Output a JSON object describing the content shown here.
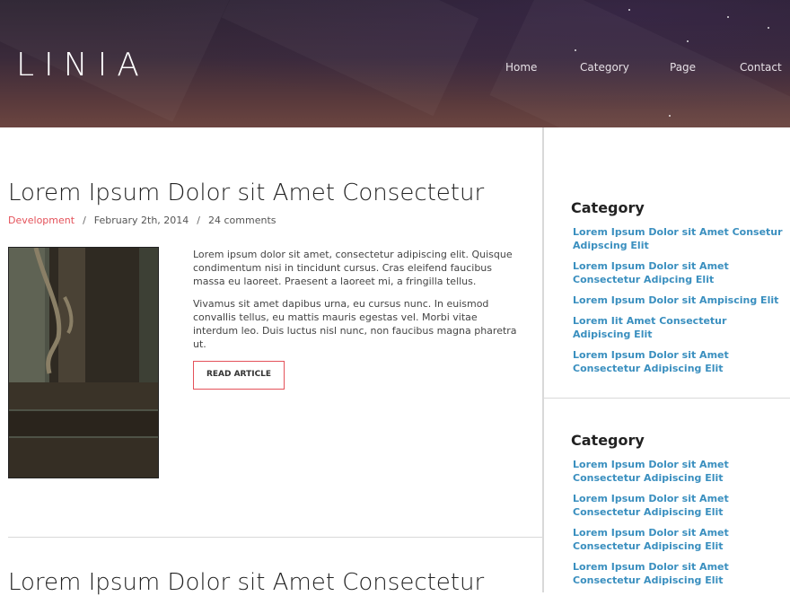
{
  "header": {
    "logo": "LINIA",
    "nav": [
      "Home",
      "Category",
      "Page",
      "Contact"
    ]
  },
  "posts": [
    {
      "title": "Lorem Ipsum Dolor sit Amet Consectetur",
      "category": "Development",
      "date": "February 2th, 2014",
      "comments": "24 comments",
      "paragraphs": [
        "Lorem ipsum dolor sit amet, consectetur adipiscing elit. Quisque condimentum nisi in tincidunt cursus. Cras eleifend faucibus massa eu laoreet. Praesent a laoreet mi, a fringilla tellus.",
        "Vivamus sit amet dapibus urna, eu cursus nunc. In euismod convallis tellus, eu mattis mauris egestas vel. Morbi vitae interdum leo. Duis luctus nisl nunc, non faucibus magna pharetra ut."
      ],
      "button": "READ ARTICLE"
    },
    {
      "title": "Lorem Ipsum Dolor sit Amet Consectetur"
    }
  ],
  "sidebar": {
    "widgets": [
      {
        "title": "Category",
        "links": [
          "Lorem Ipsum Dolor sit Amet Consetur Adipscing Elit",
          "Lorem Ipsum Dolor sit Amet Consectetur Adipcing Elit",
          "Lorem Ipsum Dolor sit Ampiscing Elit",
          "Lorem Iit Amet Consectetur Adipiscing Elit",
          "Lorem Ipsum Dolor sit Amet Consectetur Adipiscing Elit"
        ]
      },
      {
        "title": "Category",
        "links": [
          "Lorem Ipsum Dolor sit Amet Consectetur Adipiscing Elit",
          "Lorem Ipsum Dolor sit Amet Consectetur Adipiscing Elit",
          "Lorem Ipsum Dolor sit Amet Consectetur Adipiscing Elit",
          "Lorem Ipsum Dolor sit Amet Consectetur Adipiscing Elit"
        ]
      }
    ]
  },
  "colors": {
    "accent": "#e4525a",
    "link": "#3a8fbf",
    "header_dark": "#2b2230"
  }
}
